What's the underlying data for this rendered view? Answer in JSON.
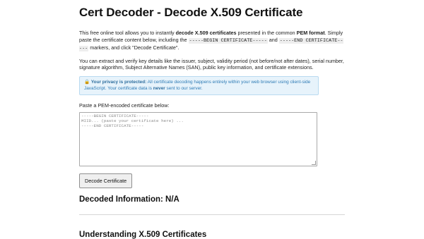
{
  "page": {
    "title": "Cert Decoder - Decode X.509 Certificate",
    "intro": {
      "t1": "This free online tool allows you to instantly ",
      "b1": "decode X.509 certificates",
      "t2": " presented in the common ",
      "b2": "PEM format",
      "t3": ". Simply paste the certificate content below, including the ",
      "c1": "-----BEGIN CERTIFICATE-----",
      "t4": " and ",
      "c2": "-----END CERTIFICATE-----",
      "t5": " markers, and click \"Decode Certificate\"."
    },
    "extract_text": "You can extract and verify key details like the issuer, subject, validity period (not before/not after dates), serial number, signature algorithm, Subject Alternative Names (SAN), public key information, and certificate extensions.",
    "privacy": {
      "icon": "lock-icon",
      "lock_glyph": "🔒",
      "bold": "Your privacy is protected:",
      "t1": " All certificate decoding happens entirely within your web browser using client-side JavaScript. Your certificate data is ",
      "never": "never",
      "t2": " sent to our server."
    },
    "paste_label": "Paste a PEM-encoded certificate below:",
    "textarea_placeholder": "-----BEGIN CERTIFICATE-----\nMIID... (paste your certificate here) ...\n-----END CERTIFICATE-----",
    "decode_button": "Decode Certificate",
    "decoded_heading": "Decoded Information: N/A",
    "understanding_heading": "Understanding X.509 Certificates"
  }
}
